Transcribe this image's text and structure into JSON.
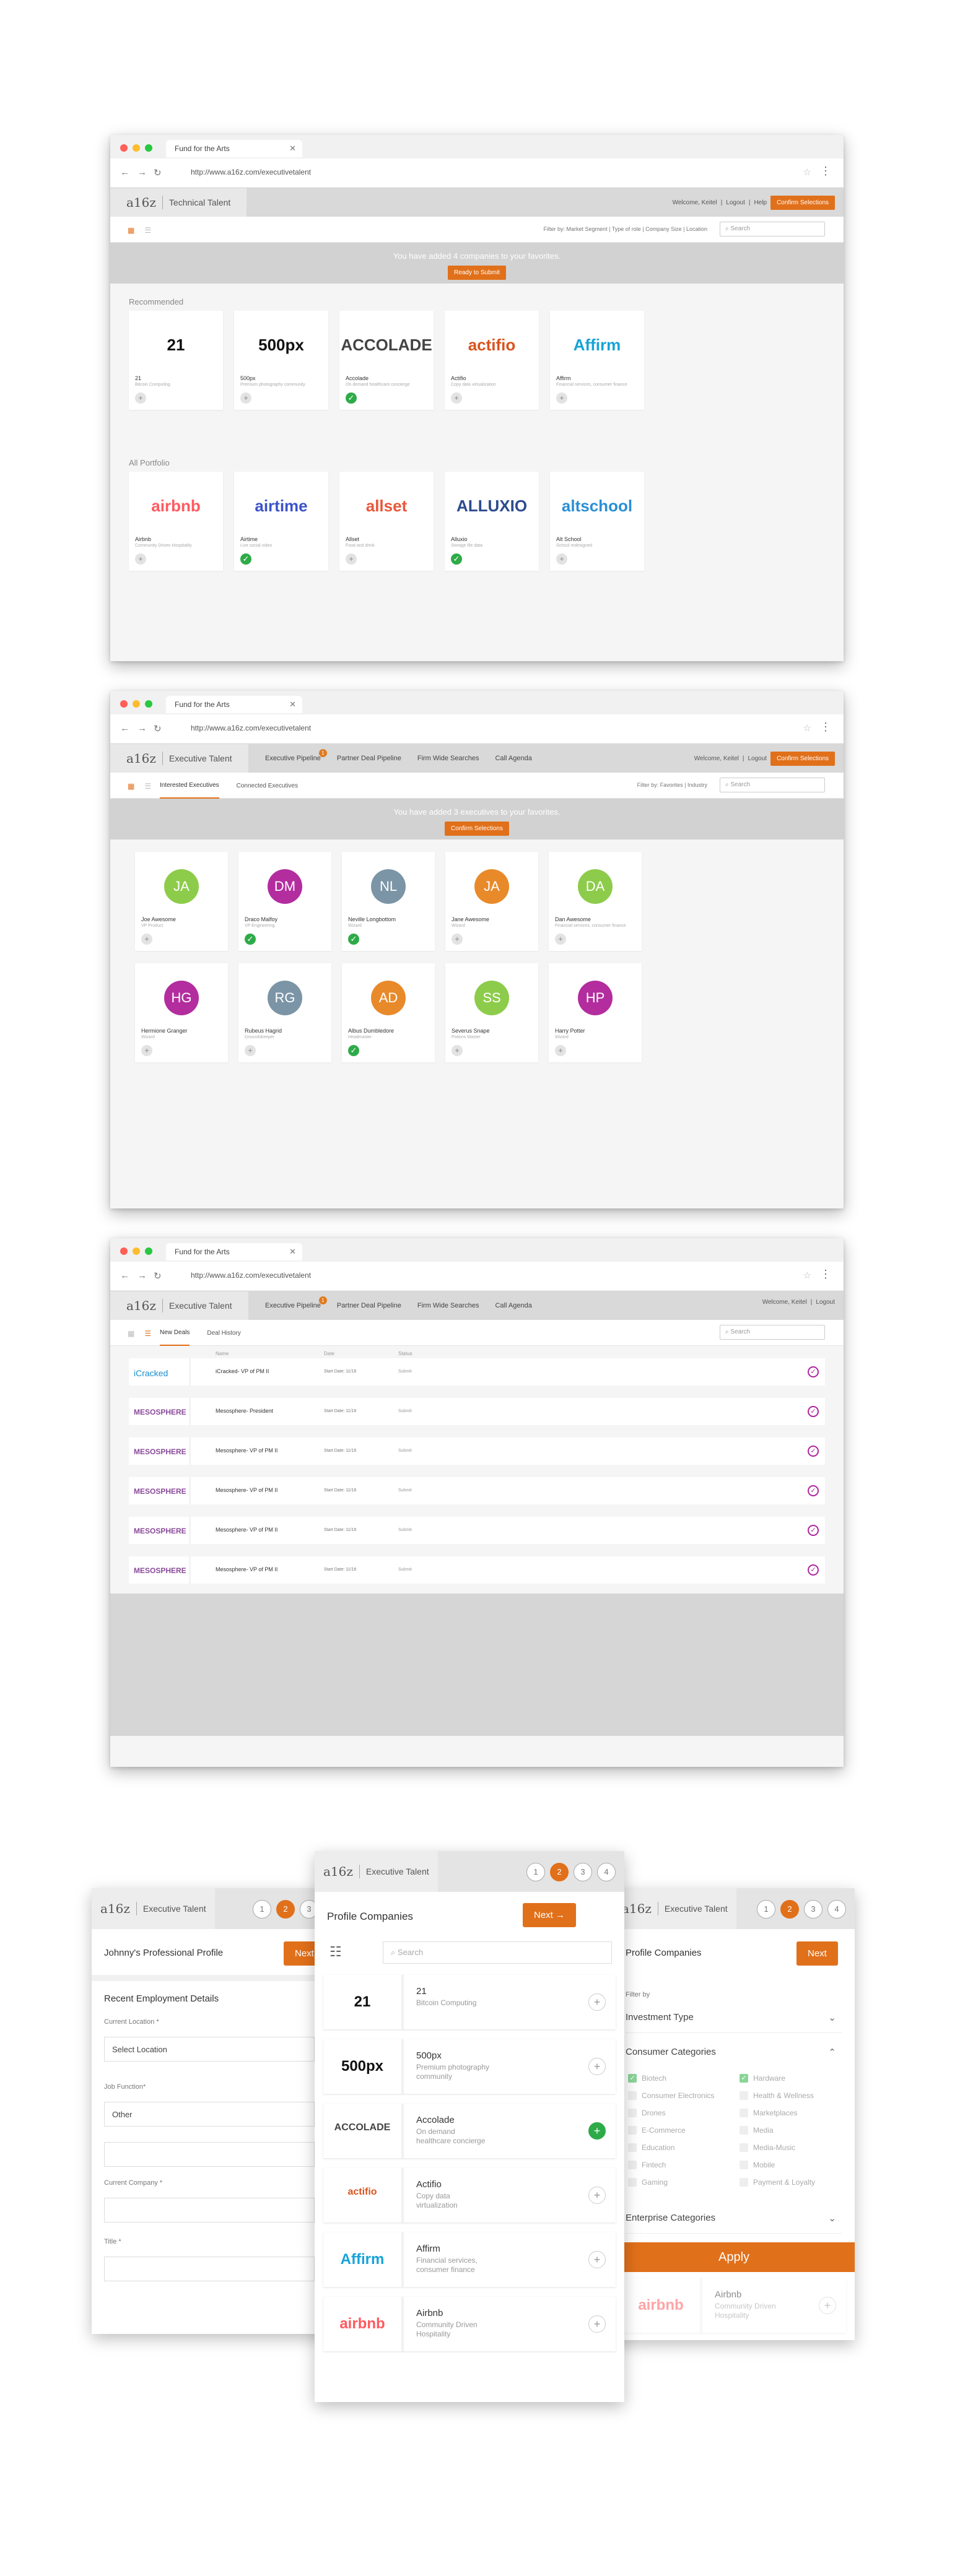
{
  "browser": {
    "tab_title": "Fund for the Arts",
    "url": "http://www.a16z.com/executivetalent",
    "colors": {
      "red": "#ff5f57",
      "yellow": "#febc2e",
      "green": "#28c840"
    }
  },
  "brand": {
    "logo": "a16z"
  },
  "screen1": {
    "product": "Technical Talent",
    "welcome": "Welcome, Keitel",
    "links": [
      "Logout",
      "Help"
    ],
    "cta": "Confirm Selections",
    "filters": "Filter by:    Market Segment  |  Type of role  |  Company Size  |  Location",
    "search_placeholder": "Search",
    "banner_msg": "You have added 4 companies to your favorites.",
    "banner_btn": "Ready to Submit",
    "recommended_label": "Recommended",
    "portfolio_label": "All Portfolio",
    "recommended": [
      {
        "logo": "21",
        "name": "21",
        "desc": "Bitcoin Computing",
        "added": false,
        "color": "#111111"
      },
      {
        "logo": "500px",
        "name": "500px",
        "desc": "Premium photography community",
        "added": false,
        "color": "#111111"
      },
      {
        "logo": "ACCOLADE",
        "name": "Accolade",
        "desc": "On demand healthcare concierge",
        "added": true,
        "color": "#444444"
      },
      {
        "logo": "actifio",
        "name": "Actifio",
        "desc": "Copy data virtualization",
        "added": false,
        "color": "#d9531e"
      },
      {
        "logo": "Affirm",
        "name": "Affirm",
        "desc": "Financial services, consumer finance",
        "added": false,
        "color": "#16a3d8"
      }
    ],
    "portfolio": [
      {
        "logo": "airbnb",
        "name": "Airbnb",
        "desc": "Community Driven Hospitality",
        "added": false,
        "color": "#ff5a5f"
      },
      {
        "logo": "airtime",
        "name": "Airtime",
        "desc": "Live social video",
        "added": true,
        "color": "#3b53c9"
      },
      {
        "logo": "allset",
        "name": "Allset",
        "desc": "Food and drink",
        "added": false,
        "color": "#e8583b"
      },
      {
        "logo": "ALLUXIO",
        "name": "Alluxio",
        "desc": "Storage file data",
        "added": true,
        "color": "#2d4b8f"
      },
      {
        "logo": "altschool",
        "name": "Alt School",
        "desc": "School redesigned",
        "added": false,
        "color": "#2a8fd6"
      }
    ]
  },
  "screen2": {
    "product": "Executive Talent",
    "nav": [
      "Executive Pipeline",
      "Partner Deal Pipeline",
      "Firm Wide Searches",
      "Call Agenda"
    ],
    "nav_badge": "1",
    "welcome": "Welcome, Keitel",
    "links": [
      "Logout"
    ],
    "cta": "Confirm Selections",
    "subtabs": [
      "Interested Executives",
      "Connected Executives"
    ],
    "filters": "Filter by:    Favorites  |  Industry",
    "search_placeholder": "Search",
    "banner_msg": "You have added 3 executives to your favorites.",
    "banner_btn": "Confirm Selections",
    "people": [
      {
        "initials": "JA",
        "name": "Joe Awesome",
        "role": "VP Product",
        "added": false,
        "color": "#8dcc4b"
      },
      {
        "initials": "DM",
        "name": "Draco Malfoy",
        "role": "VP Engineering",
        "added": true,
        "color": "#b32d9f"
      },
      {
        "initials": "NL",
        "name": "Neville Longbottom",
        "role": "Wizard",
        "added": true,
        "color": "#7b95a6"
      },
      {
        "initials": "JA",
        "name": "Jane Awesome",
        "role": "Wizard",
        "added": false,
        "color": "#e88a2a"
      },
      {
        "initials": "DA",
        "name": "Dan Awesome",
        "role": "Financial services, consumer finance",
        "added": false,
        "color": "#8dcc4b"
      },
      {
        "initials": "HG",
        "name": "Hermione Granger",
        "role": "Wizard",
        "added": false,
        "color": "#b32d9f"
      },
      {
        "initials": "RG",
        "name": "Rubeus Hagrid",
        "role": "Groundskeeper",
        "added": false,
        "color": "#7b95a6"
      },
      {
        "initials": "AD",
        "name": "Albus Dumbledore",
        "role": "Headmaster",
        "added": true,
        "color": "#e88a2a"
      },
      {
        "initials": "SS",
        "name": "Severus Snape",
        "role": "Potions Master",
        "added": false,
        "color": "#8dcc4b"
      },
      {
        "initials": "HP",
        "name": "Harry Potter",
        "role": "Wizard",
        "added": false,
        "color": "#b32d9f"
      }
    ]
  },
  "screen3": {
    "product": "Executive Talent",
    "nav": [
      "Executive Pipeline",
      "Partner Deal Pipeline",
      "Firm Wide Searches",
      "Call Agenda"
    ],
    "nav_badge": "1",
    "welcome": "Welcome, Keitel",
    "links": [
      "Logout"
    ],
    "subtabs": [
      "New Deals",
      "Deal History"
    ],
    "search_placeholder": "Search",
    "columns": [
      "Name",
      "Date",
      "Status"
    ],
    "deals": [
      {
        "company": "iCracked",
        "title": "iCracked- VP of PM II",
        "date": "Start Date: 11/16",
        "status": "Submit"
      },
      {
        "company": "MESOSPHERE",
        "title": "Mesosphere- President",
        "date": "Start Date: 11/16",
        "status": "Submit"
      },
      {
        "company": "MESOSPHERE",
        "title": "Mesosphere- VP of PM II",
        "date": "Start Date: 11/16",
        "status": "Submit"
      },
      {
        "company": "MESOSPHERE",
        "title": "Mesosphere- VP of PM II",
        "date": "Start Date: 11/16",
        "status": "Submit"
      },
      {
        "company": "MESOSPHERE",
        "title": "Mesosphere- VP of PM II",
        "date": "Start Date: 11/16",
        "status": "Submit"
      },
      {
        "company": "MESOSPHERE",
        "title": "Mesosphere- VP of PM II",
        "date": "Start Date: 11/16",
        "status": "Submit"
      }
    ]
  },
  "mobile": {
    "product": "Executive Talent",
    "steps": [
      "1",
      "2",
      "3",
      "4"
    ],
    "next": "Next",
    "left": {
      "title": "Johnny's Professional Profile",
      "section": "Recent Employment Details",
      "fields": [
        {
          "label": "Current Location *",
          "value": "Select Location"
        },
        {
          "label": "Job Function*",
          "value": "Other"
        },
        {
          "label": "",
          "value": ""
        },
        {
          "label": "Current Company *",
          "value": ""
        },
        {
          "label": "Title *",
          "value": ""
        }
      ]
    },
    "center": {
      "title": "Profile Companies",
      "search_placeholder": "Search",
      "companies": [
        {
          "logo": "21",
          "name": "21",
          "desc": "Bitcoin Computing",
          "added": false,
          "color": "#111111"
        },
        {
          "logo": "500px",
          "name": "500px",
          "desc": "Premium photography community",
          "added": false,
          "color": "#111111"
        },
        {
          "logo": "ACCOLADE",
          "name": "Accolade",
          "desc": "On demand healthcare concierge",
          "added": true,
          "color": "#444444"
        },
        {
          "logo": "actifio",
          "name": "Actifio",
          "desc": "Copy data virtualization",
          "added": false,
          "color": "#d9531e"
        },
        {
          "logo": "Affirm",
          "name": "Affirm",
          "desc": "Financial services, consumer finance",
          "added": false,
          "color": "#16a3d8"
        },
        {
          "logo": "airbnb",
          "name": "Airbnb",
          "desc": "Community Driven Hospitality",
          "added": false,
          "color": "#ff5a5f"
        }
      ]
    },
    "right": {
      "title": "Profile Companies",
      "filter_label": "Filter by",
      "cat1": "Investment Type",
      "cat2": "Consumer Categories",
      "options": [
        {
          "label": "Biotech",
          "on": true
        },
        {
          "label": "Hardware",
          "on": true
        },
        {
          "label": "Consumer Electronics",
          "on": false
        },
        {
          "label": "Health & Wellness",
          "on": false
        },
        {
          "label": "Drones",
          "on": false
        },
        {
          "label": "Marketplaces",
          "on": false
        },
        {
          "label": "E-Commerce",
          "on": false
        },
        {
          "label": "Media",
          "on": false
        },
        {
          "label": "Education",
          "on": false
        },
        {
          "label": "Media-Music",
          "on": false
        },
        {
          "label": "Fintech",
          "on": false
        },
        {
          "label": "Mobile",
          "on": false
        },
        {
          "label": "Gaming",
          "on": false
        },
        {
          "label": "Payment & Loyalty",
          "on": false
        }
      ],
      "cat3": "Enterprise Categories",
      "apply": "Apply",
      "bottom_name": "Airbnb",
      "bottom_desc": "Community Driven Hospitality",
      "bottom_logo": "airbnb"
    }
  }
}
